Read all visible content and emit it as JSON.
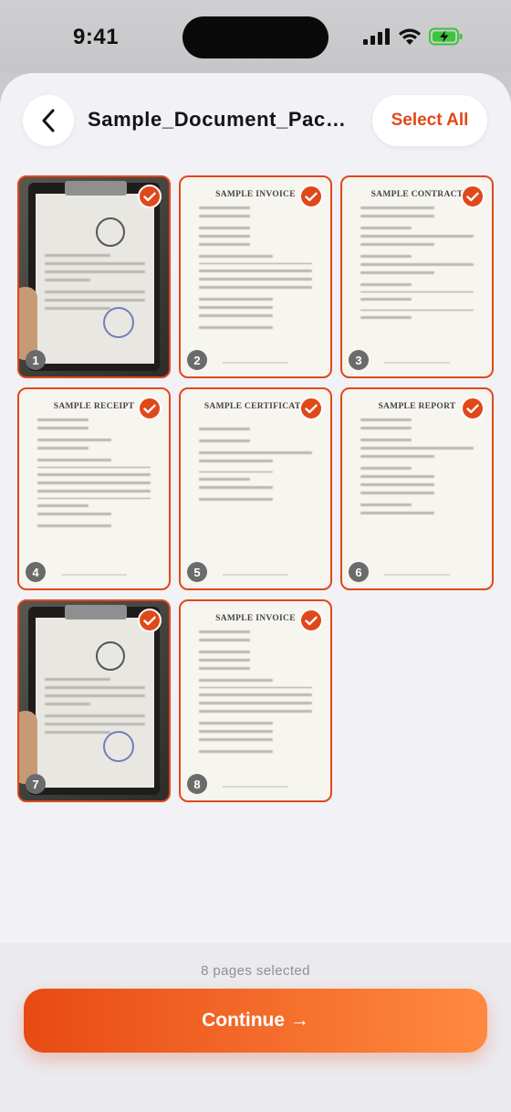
{
  "status_bar": {
    "time": "9:41"
  },
  "header": {
    "title": "Sample_Document_Pack...",
    "select_all_label": "Select All"
  },
  "pages": [
    {
      "number": "1",
      "kind": "photo",
      "title": "",
      "selected": true
    },
    {
      "number": "2",
      "kind": "document",
      "title": "SAMPLE INVOICE",
      "selected": true
    },
    {
      "number": "3",
      "kind": "document",
      "title": "SAMPLE CONTRACT",
      "selected": true
    },
    {
      "number": "4",
      "kind": "document",
      "title": "SAMPLE RECEIPT",
      "selected": true
    },
    {
      "number": "5",
      "kind": "document",
      "title": "SAMPLE CERTIFICATE",
      "selected": true
    },
    {
      "number": "6",
      "kind": "document",
      "title": "SAMPLE REPORT",
      "selected": true
    },
    {
      "number": "7",
      "kind": "photo",
      "title": "",
      "selected": true
    },
    {
      "number": "8",
      "kind": "document",
      "title": "SAMPLE INVOICE",
      "selected": true
    }
  ],
  "footer": {
    "selected_text": "8 pages selected",
    "continue_label": "Continue →"
  },
  "colors": {
    "accent": "#e0481a",
    "button_gradient_start": "#e84a14",
    "button_gradient_end": "#ff8a3f"
  },
  "icons": {
    "back": "chevron-left-icon",
    "check": "checkmark-icon",
    "signal": "signal-icon",
    "wifi": "wifi-icon",
    "battery": "battery-charging-icon"
  }
}
